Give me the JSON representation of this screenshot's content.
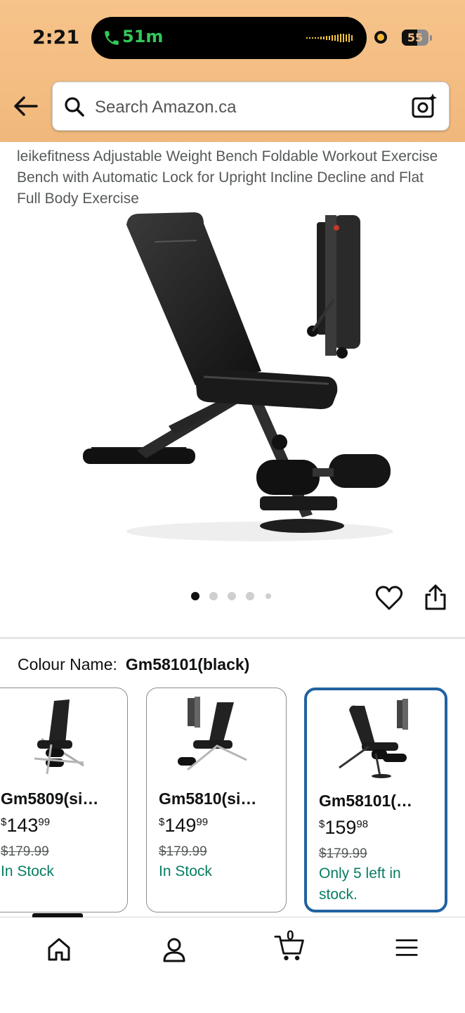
{
  "status_bar": {
    "time": "2:21",
    "call_duration": "51m",
    "battery": "55"
  },
  "search": {
    "placeholder": "Search Amazon.ca"
  },
  "product": {
    "title": "leikefitness Adjustable Weight Bench Foldable Workout Exercise Bench with Automatic Lock for Upright Incline Decline and Flat Full Body Exercise",
    "image_count": 5,
    "current_image": 1
  },
  "colour": {
    "label": "Colour Name:",
    "selected": "Gm58101(black)"
  },
  "swatches": [
    {
      "name": "Gm5809(si…",
      "currency": "$",
      "price_whole": "143",
      "price_cents": "99",
      "list_price": "$179.99",
      "stock": "In Stock",
      "selected": false
    },
    {
      "name": "Gm5810(si…",
      "currency": "$",
      "price_whole": "149",
      "price_cents": "99",
      "list_price": "$179.99",
      "stock": "In Stock",
      "selected": false
    },
    {
      "name": "Gm58101(…",
      "currency": "$",
      "price_whole": "159",
      "price_cents": "98",
      "list_price": "$179.99",
      "stock": "Only 5 left in stock.",
      "selected": true
    }
  ],
  "bottom_nav": {
    "cart_count": "0",
    "items": [
      "home-icon",
      "account-icon",
      "cart-icon",
      "menu-icon"
    ]
  },
  "colors": {
    "header": "#f3bd82",
    "selected_border": "#2162a1",
    "stock_green": "#067d62",
    "call_green": "#34c759"
  }
}
